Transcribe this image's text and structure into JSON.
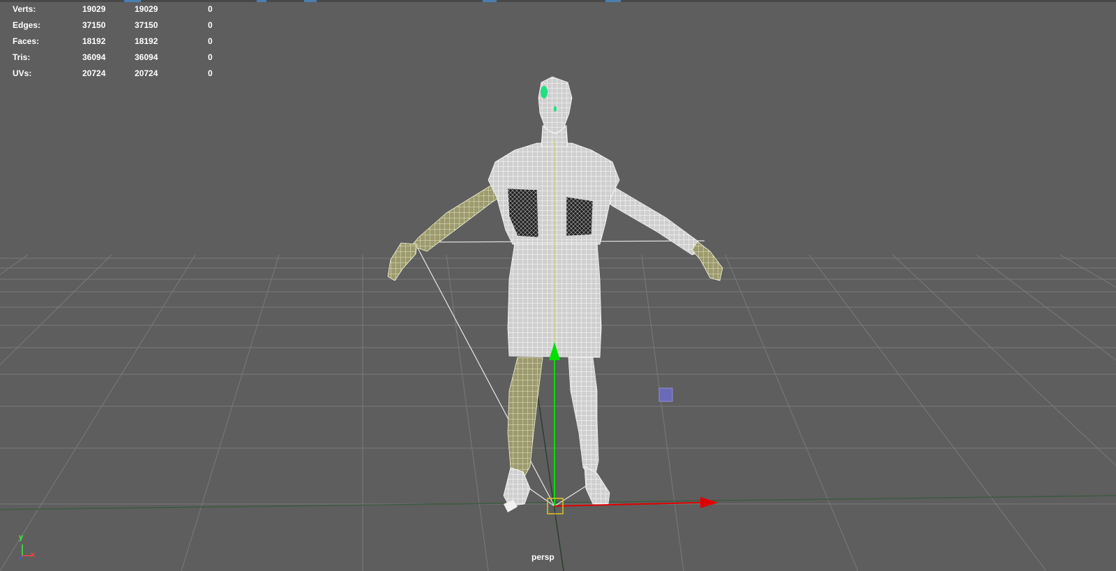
{
  "hud": {
    "rows": [
      {
        "label": "Verts:",
        "v1": "19029",
        "v2": "19029",
        "v3": "0"
      },
      {
        "label": "Edges:",
        "v1": "37150",
        "v2": "37150",
        "v3": "0"
      },
      {
        "label": "Faces:",
        "v1": "18192",
        "v2": "18192",
        "v3": "0"
      },
      {
        "label": "Tris:",
        "v1": "36094",
        "v2": "36094",
        "v3": "0"
      },
      {
        "label": "UVs:",
        "v1": "20724",
        "v2": "20724",
        "v3": "0"
      }
    ]
  },
  "camera": {
    "name": "persp"
  },
  "axis_indicator": {
    "y_label": "y",
    "x_label": "x"
  },
  "colors": {
    "background": "#5e5e5e",
    "grid": "#7a7a7a",
    "y_axis_manipulator": "#00e000",
    "x_axis_manipulator": "#e00000",
    "pivot_box": "#e0c020",
    "selection_highlight": "#20e080",
    "locator": "#6a6ab8"
  },
  "icons": [
    "move-manipulator-icon",
    "view-axis-icon"
  ]
}
